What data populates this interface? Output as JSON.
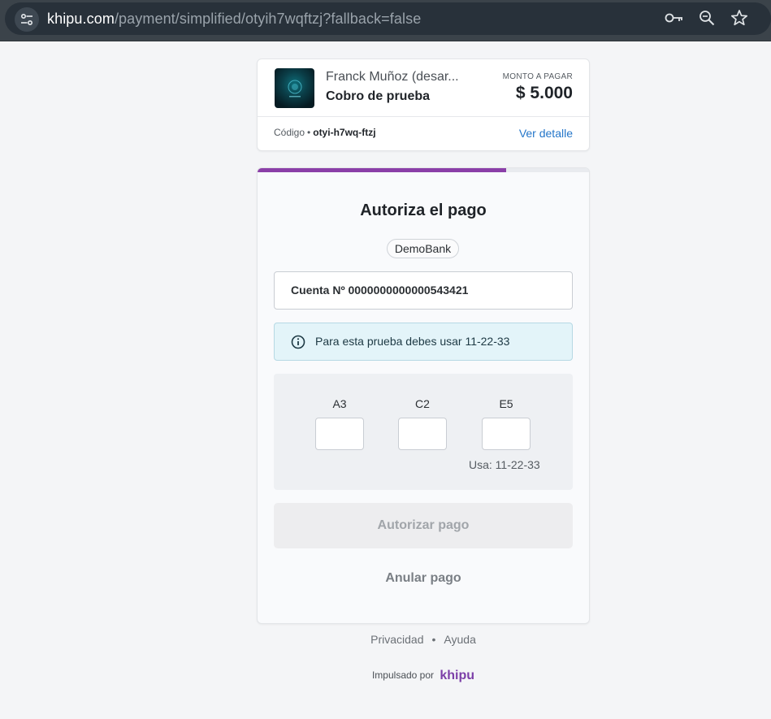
{
  "browser": {
    "url_domain": "khipu.com",
    "url_path": "/payment/simplified/otyih7wqftzj?fallback=false",
    "icons": [
      "site-settings-icon",
      "key-icon",
      "zoom-icon",
      "star-icon"
    ]
  },
  "header": {
    "merchant_name": "Franck Muñoz (desar...",
    "subject": "Cobro de prueba",
    "amount_label": "MONTO A PAGAR",
    "amount": "$ 5.000",
    "code_label": "Código",
    "code_separator": "•",
    "code_value": "otyi-h7wq-ftzj",
    "detail_link": "Ver detalle"
  },
  "progress": {
    "fraction": 0.75,
    "color": "#8b3fa8"
  },
  "authorize": {
    "title": "Autoriza el pago",
    "bank": "DemoBank",
    "account": "Cuenta Nº 0000000000000543421",
    "info_text": "Para esta prueba debes usar 11-22-33",
    "coordinates": [
      {
        "label": "A3",
        "value": ""
      },
      {
        "label": "C2",
        "value": ""
      },
      {
        "label": "E5",
        "value": ""
      }
    ],
    "hint": "Usa: 11-22-33",
    "authorize_button": "Autorizar pago",
    "cancel_button": "Anular pago"
  },
  "footer": {
    "privacy": "Privacidad",
    "separator": "•",
    "help": "Ayuda",
    "powered_by": "Impulsado por",
    "brand": "khipu"
  },
  "colors": {
    "accent_purple": "#8b3fa8",
    "link_blue": "#2476c9",
    "info_bg": "#e3f4f9"
  }
}
